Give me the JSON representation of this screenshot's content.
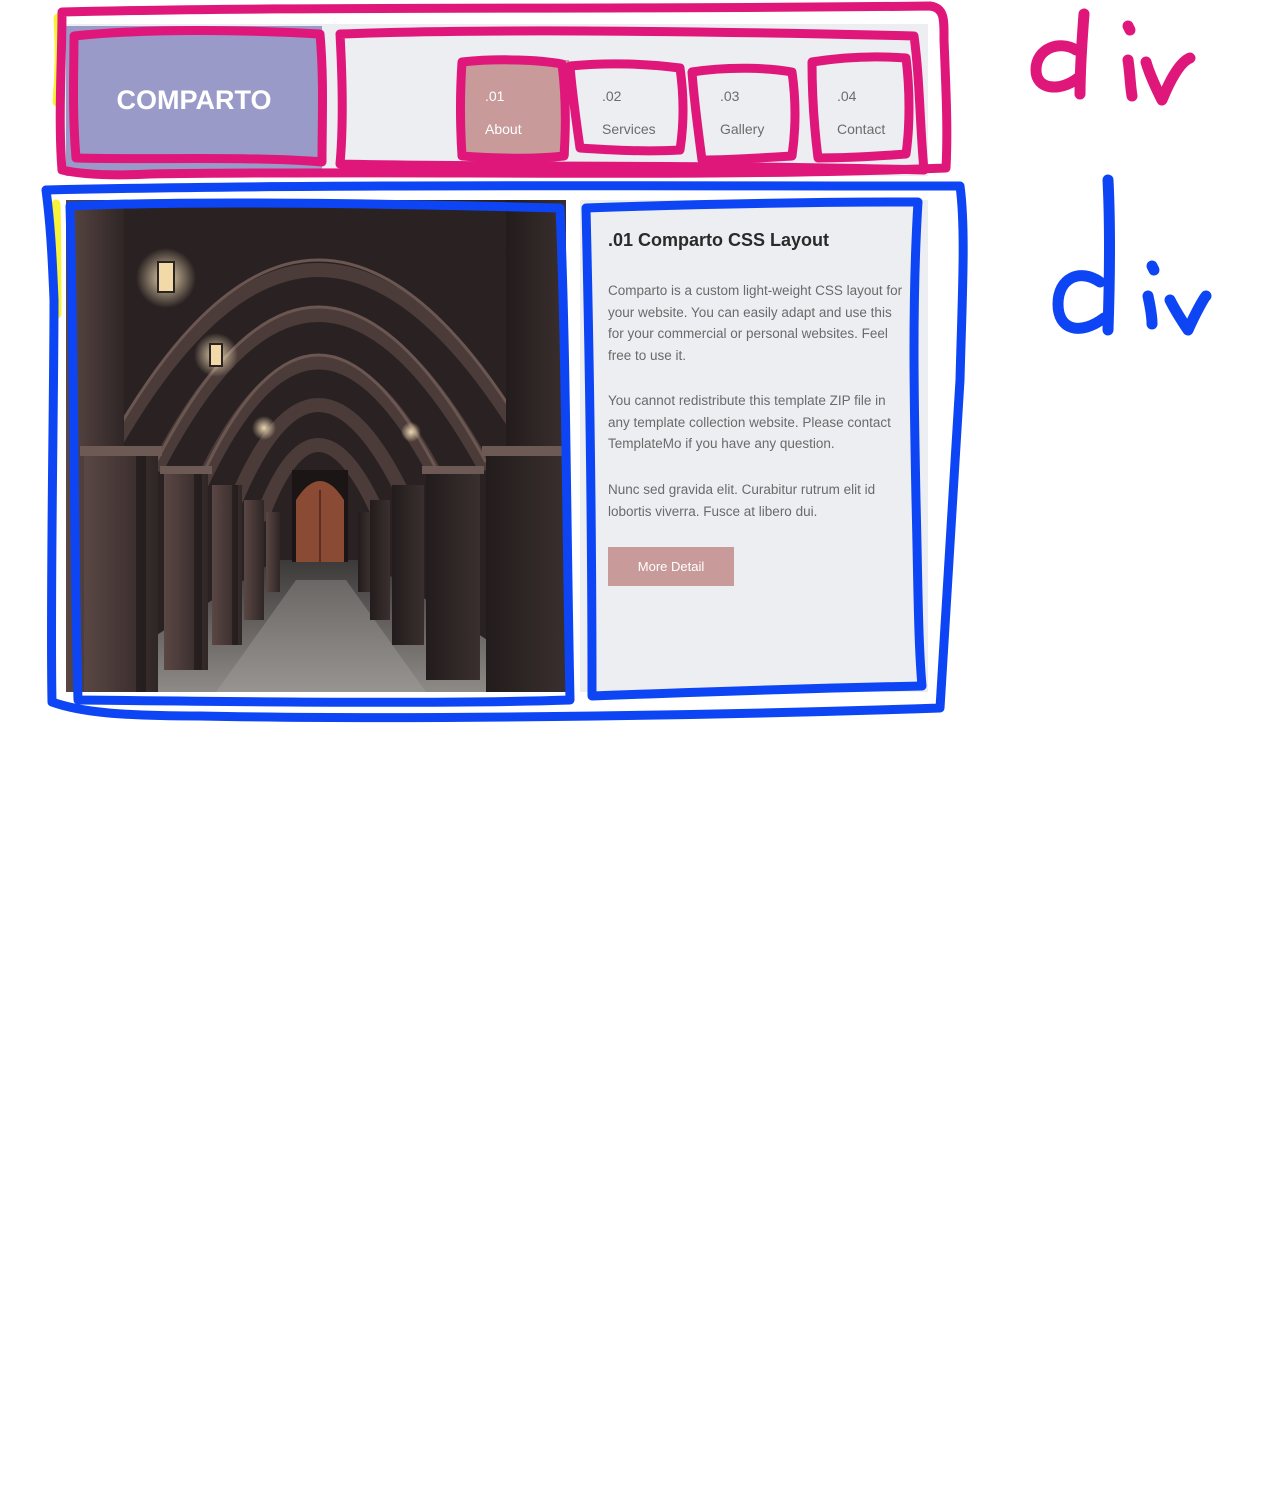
{
  "header": {
    "logo": "COMPARTO",
    "nav": [
      {
        "num": ".01",
        "label": "About",
        "active": true
      },
      {
        "num": ".02",
        "label": "Services",
        "active": false
      },
      {
        "num": ".03",
        "label": "Gallery",
        "active": false
      },
      {
        "num": ".04",
        "label": "Contact",
        "active": false
      }
    ]
  },
  "content": {
    "title": ".01 Comparto CSS Layout",
    "paragraphs": [
      "Comparto is a custom light-weight CSS layout for your website. You can easily adapt and use this for your commercial or personal websites. Feel free to use it.",
      "You cannot redistribute this template ZIP file in any template collection website. Please contact TemplateMo if you have any question.",
      "Nunc sed gravida elit. Curabitur rutrum elit id lobortis viverra. Fusce at libero dui."
    ],
    "button": "More Detail"
  },
  "annotations": {
    "top_label": "div",
    "bottom_label": "div",
    "pink_color": "#e0177a",
    "blue_color": "#0d45f5",
    "yellow_color": "#f7f23a"
  },
  "colors": {
    "logo_bg": "#9a9ac9",
    "accent": "#c89a9a",
    "panel_bg": "#eceef1"
  }
}
